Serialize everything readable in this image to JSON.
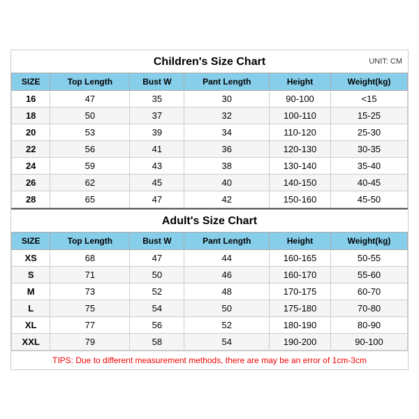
{
  "children_section": {
    "title": "Children's Size Chart",
    "unit": "UNIT: CM",
    "headers": [
      "SIZE",
      "Top Length",
      "Bust W",
      "Pant Length",
      "Height",
      "Weight(kg)"
    ],
    "rows": [
      [
        "16",
        "47",
        "35",
        "30",
        "90-100",
        "<15"
      ],
      [
        "18",
        "50",
        "37",
        "32",
        "100-110",
        "15-25"
      ],
      [
        "20",
        "53",
        "39",
        "34",
        "110-120",
        "25-30"
      ],
      [
        "22",
        "56",
        "41",
        "36",
        "120-130",
        "30-35"
      ],
      [
        "24",
        "59",
        "43",
        "38",
        "130-140",
        "35-40"
      ],
      [
        "26",
        "62",
        "45",
        "40",
        "140-150",
        "40-45"
      ],
      [
        "28",
        "65",
        "47",
        "42",
        "150-160",
        "45-50"
      ]
    ]
  },
  "adult_section": {
    "title": "Adult's Size Chart",
    "headers": [
      "SIZE",
      "Top Length",
      "Bust W",
      "Pant Length",
      "Height",
      "Weight(kg)"
    ],
    "rows": [
      [
        "XS",
        "68",
        "47",
        "44",
        "160-165",
        "50-55"
      ],
      [
        "S",
        "71",
        "50",
        "46",
        "160-170",
        "55-60"
      ],
      [
        "M",
        "73",
        "52",
        "48",
        "170-175",
        "60-70"
      ],
      [
        "L",
        "75",
        "54",
        "50",
        "175-180",
        "70-80"
      ],
      [
        "XL",
        "77",
        "56",
        "52",
        "180-190",
        "80-90"
      ],
      [
        "XXL",
        "79",
        "58",
        "54",
        "190-200",
        "90-100"
      ]
    ]
  },
  "tips": "TIPS: Due to different measurement methods, there are may be an error of 1cm-3cm"
}
